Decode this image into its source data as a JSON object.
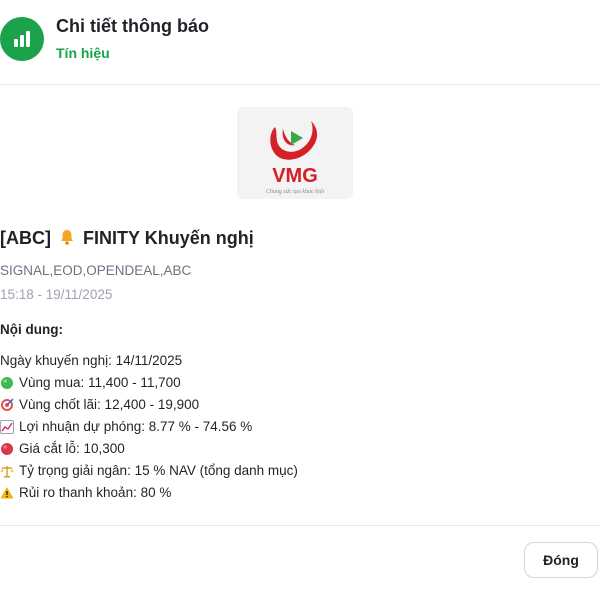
{
  "header": {
    "title": "Chi tiết thông báo",
    "subtitle": "Tín hiệu",
    "icon": "bar-chart-icon",
    "accent_color": "#1aa34a"
  },
  "logo": {
    "text": "VMG",
    "tagline": "Chung sức tạo khác biệt"
  },
  "notification": {
    "title_prefix": "[ABC]",
    "title_icon": "bell-icon",
    "title_text": "FINITY Khuyến nghị",
    "tags": "SIGNAL,EOD,OPENDEAL,ABC",
    "timestamp": "15:18 - 19/11/2025",
    "content_label": "Nội dung:",
    "lines": [
      {
        "icon": "",
        "text": "Ngày khuyến nghị: 14/11/2025"
      },
      {
        "icon": "green-circle-icon",
        "text": "Vùng mua: 11,400 - 11,700"
      },
      {
        "icon": "target-icon",
        "text": "Vùng chốt lãi: 12,400 - 19,900"
      },
      {
        "icon": "chart-increasing-icon",
        "text": "Lợi nhuận dự phóng: 8.77 % - 74.56 %"
      },
      {
        "icon": "red-circle-icon",
        "text": "Giá cắt lỗ: 10,300"
      },
      {
        "icon": "balance-scale-icon",
        "text": "Tỷ trọng giải ngân: 15 % NAV (tổng danh mục)"
      },
      {
        "icon": "warning-icon",
        "text": "Rủi ro thanh khoản: 80 %"
      }
    ]
  },
  "footer": {
    "close_label": "Đóng"
  }
}
